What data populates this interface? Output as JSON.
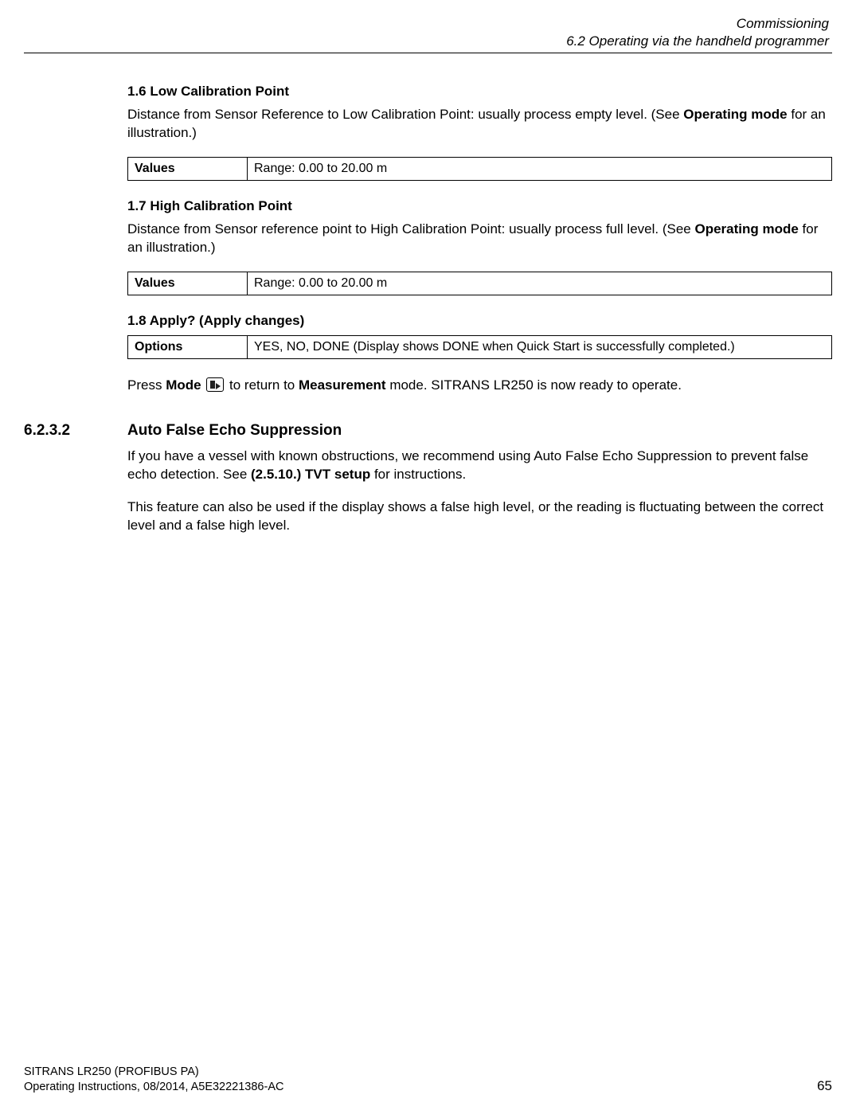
{
  "header": {
    "chapter": "Commissioning",
    "section": "6.2 Operating via the handheld programmer"
  },
  "s16": {
    "title": "1.6 Low Calibration Point",
    "desc_a": "Distance from Sensor Reference to Low Calibration Point: usually process empty level. (See ",
    "desc_b": "Operating mode",
    "desc_c": " for an illustration.)",
    "tbl_label": "Values",
    "tbl_value": "Range: 0.00 to 20.00 m"
  },
  "s17": {
    "title": "1.7 High Calibration Point",
    "desc_a": "Distance from Sensor reference point to High Calibration Point: usually process full level. (See ",
    "desc_b": "Operating mode",
    "desc_c": " for an illustration.)",
    "tbl_label": "Values",
    "tbl_value": "Range: 0.00 to 20.00 m"
  },
  "s18": {
    "title": "1.8 Apply? (Apply changes)",
    "tbl_label": "Options",
    "tbl_value": "YES, NO, DONE (Display shows DONE when Quick Start is successfully completed.)",
    "after_a": "Press ",
    "after_b": "Mode",
    "after_c": " to return to ",
    "after_d": "Measurement",
    "after_e": " mode. SITRANS LR250 is now ready to operate."
  },
  "sub": {
    "num": "6.2.3.2",
    "title": "Auto False Echo Suppression",
    "p1_a": "If you have a vessel with known obstructions, we recommend using Auto False Echo Suppression to prevent false echo detection. See ",
    "p1_b": "(2.5.10.) TVT setup",
    "p1_c": " for instructions.",
    "p2": "This feature can also be used if the display shows a false high level, or the reading is fluctuating between the correct level and a false high level."
  },
  "footer": {
    "product": "SITRANS LR250 (PROFIBUS PA)",
    "docinfo": "Operating Instructions, 08/2014, A5E32221386-AC",
    "page": "65"
  }
}
